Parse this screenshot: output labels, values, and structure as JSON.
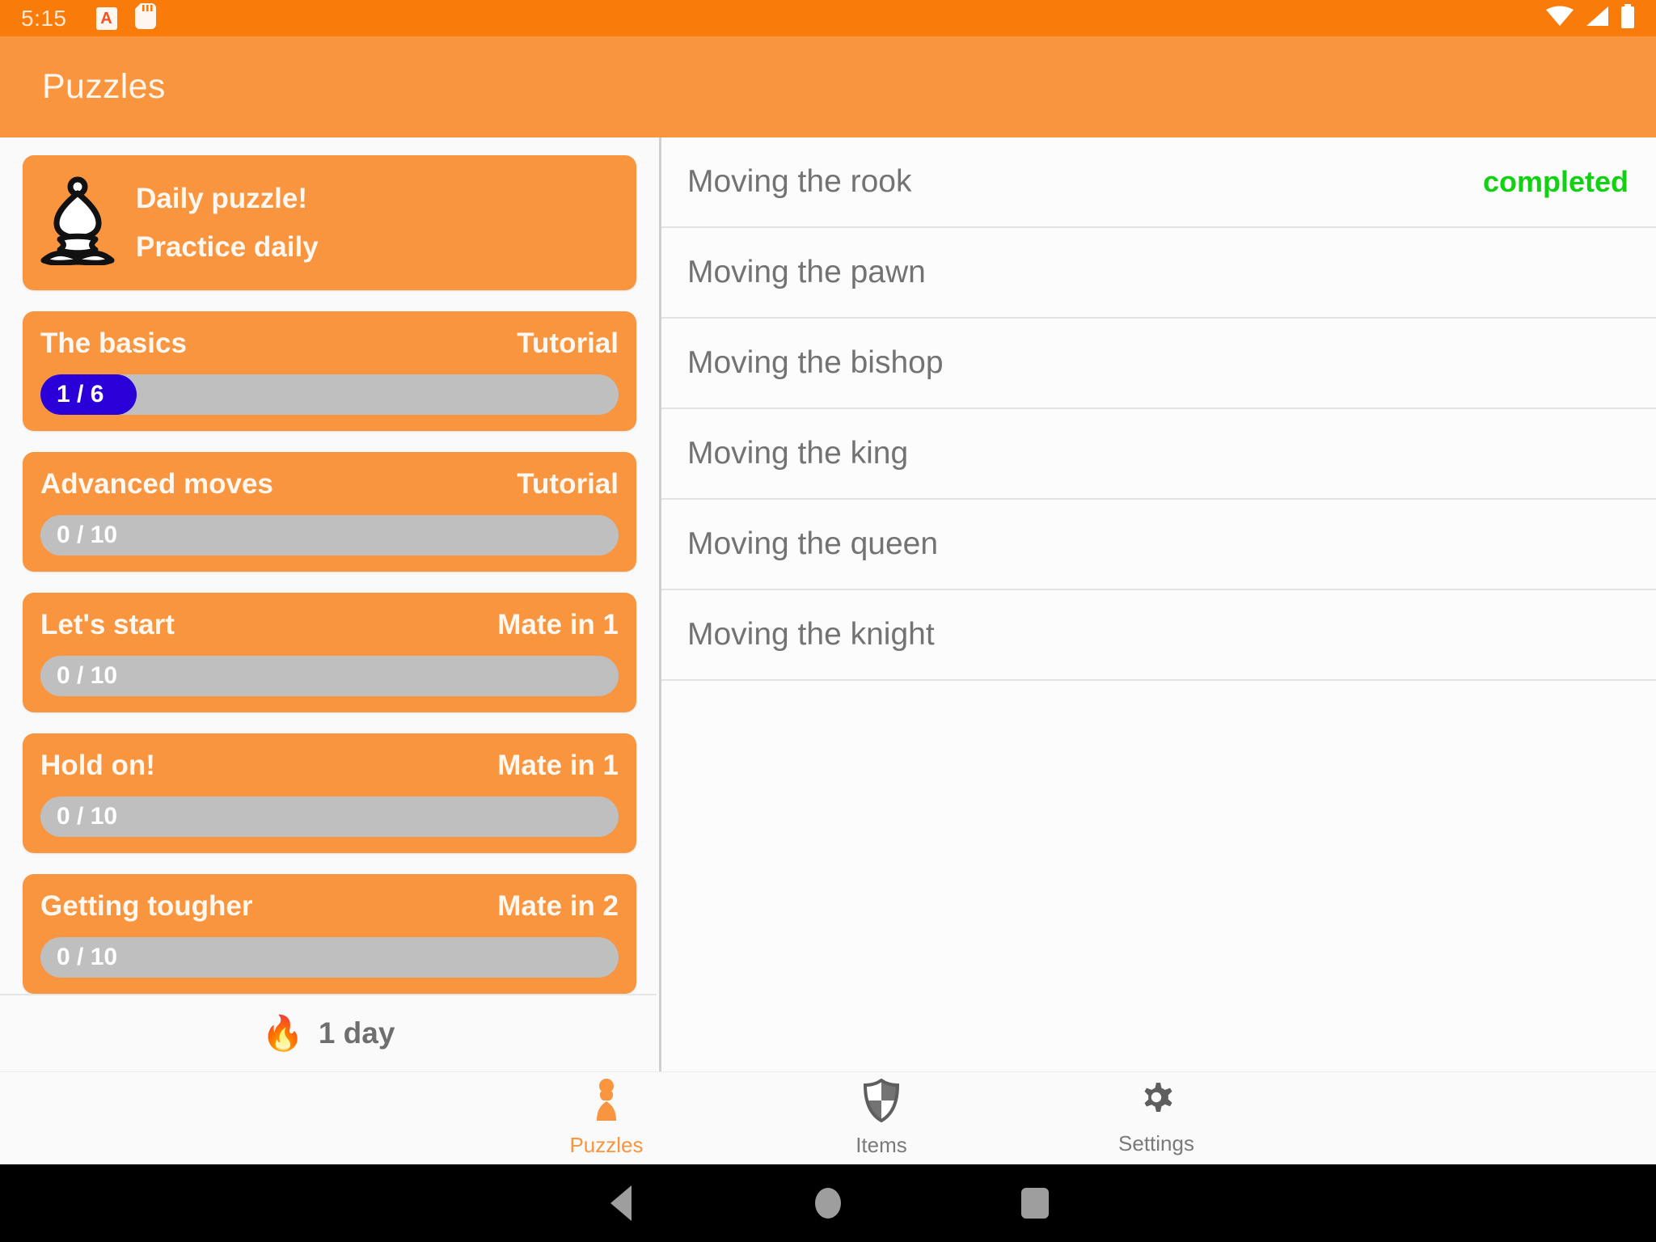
{
  "status_bar": {
    "time": "5:15",
    "icons_left": [
      "app-a-icon",
      "sd-card-icon"
    ],
    "icons_right": [
      "wifi-icon",
      "cell-signal-icon",
      "battery-icon"
    ],
    "background_color": "#F97C0B"
  },
  "app_bar": {
    "title": "Puzzles",
    "background_color": "#F9943F",
    "text_color": "#FFF6EC"
  },
  "left_panel": {
    "daily_card": {
      "icon": "chess-bishop-icon",
      "line1": "Daily puzzle!",
      "line2": "Practice daily"
    },
    "cards": [
      {
        "title": "The basics",
        "tag": "Tutorial",
        "progress_label": "1 / 6",
        "percent": 16.6
      },
      {
        "title": "Advanced moves",
        "tag": "Tutorial",
        "progress_label": "0 / 10",
        "percent": 0
      },
      {
        "title": "Let's start",
        "tag": "Mate in 1",
        "progress_label": "0 / 10",
        "percent": 0
      },
      {
        "title": "Hold on!",
        "tag": "Mate in 1",
        "progress_label": "0 / 10",
        "percent": 0
      },
      {
        "title": "Getting tougher",
        "tag": "Mate in 2",
        "progress_label": "0 / 10",
        "percent": 0
      }
    ],
    "streak": {
      "icon": "flame-icon",
      "glyph": "🔥",
      "text": "1 day"
    },
    "card_color": "#F9943F",
    "progress_track_color": "#BFBFBF",
    "progress_fill_color": "#2B00D8"
  },
  "right_panel": {
    "lessons": [
      {
        "title": "Moving the rook",
        "status": "completed"
      },
      {
        "title": "Moving the pawn",
        "status": ""
      },
      {
        "title": "Moving the bishop",
        "status": ""
      },
      {
        "title": "Moving the king",
        "status": ""
      },
      {
        "title": "Moving the queen",
        "status": ""
      },
      {
        "title": "Moving the knight",
        "status": ""
      }
    ],
    "completed_color": "#12D012",
    "title_color": "#737373"
  },
  "bottom_nav": {
    "items": [
      {
        "label": "Puzzles",
        "icon": "chess-pawn-icon",
        "active": true
      },
      {
        "label": "Items",
        "icon": "shield-icon",
        "active": false
      },
      {
        "label": "Settings",
        "icon": "gear-icon",
        "active": false
      }
    ],
    "active_color": "#F9943F",
    "inactive_color": "#7A7A7A"
  },
  "android_nav": {
    "buttons": [
      "back-icon",
      "home-icon",
      "recents-icon"
    ]
  }
}
